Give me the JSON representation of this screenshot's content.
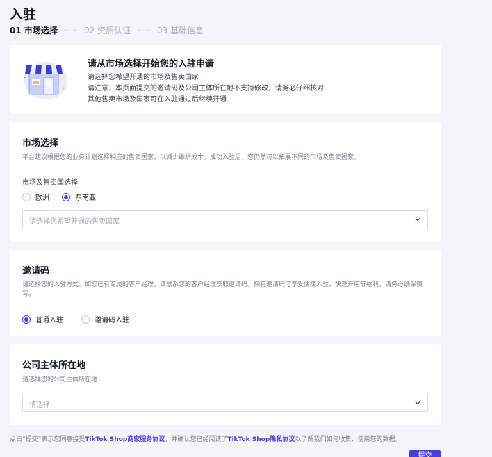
{
  "page": {
    "title": "入驻"
  },
  "steps": [
    {
      "label": "01 市场选择",
      "active": true
    },
    {
      "label": "02 资质认证",
      "active": false
    },
    {
      "label": "03 基础信息",
      "active": false
    }
  ],
  "step_separator": "····",
  "intro": {
    "title": "请从市场选择开始您的入驻申请",
    "line1": "请选择您希望开通的市场及售卖国家",
    "line2": "请注意，本页面提交的邀请码及公司主体所在地不支持修改，请务必仔细核对",
    "line3": "其他售卖市场及国家可在入驻通过后继续开通",
    "illustration_icon": "storefront-icon"
  },
  "market": {
    "title": "市场选择",
    "description": "平台建议根据您的业务计划选择相应的售卖国家，以减少维护成本。成功入驻后，您仍然可以拓展不同的市场及售卖国家。",
    "field_label": "市场及售卖国选择",
    "options": [
      {
        "label": "欧洲",
        "checked": false
      },
      {
        "label": "东南亚",
        "checked": true
      }
    ],
    "select_placeholder": "请选择您希望开通的售卖国家"
  },
  "invite": {
    "title": "邀请码",
    "description": "请选择您的入驻方式。如您已有专属的客户经理，请联系您的客户经理获取邀请码。拥有邀请码可享受便捷入驻、快速开店等福利，请务必确保填写。",
    "options": [
      {
        "label": "普通入驻",
        "checked": true
      },
      {
        "label": "邀请码入驻",
        "checked": false
      }
    ]
  },
  "company": {
    "title": "公司主体所在地",
    "description": "请选择您的公司主体所在地",
    "select_placeholder": "请选择"
  },
  "footer": {
    "prefix": "点击“提交”表示您同意接受",
    "link1": "TikTok Shop商家服务协议",
    "middle": "，并确认您已经阅读了",
    "link2": "TikTok Shop隐私协议",
    "suffix": "以了解我们如何收集、使用您的数据。"
  },
  "submit_button": {
    "label": "提交"
  },
  "colors": {
    "accent": "#4a3ed8",
    "background": "#f5f5f7",
    "card": "#ffffff"
  }
}
